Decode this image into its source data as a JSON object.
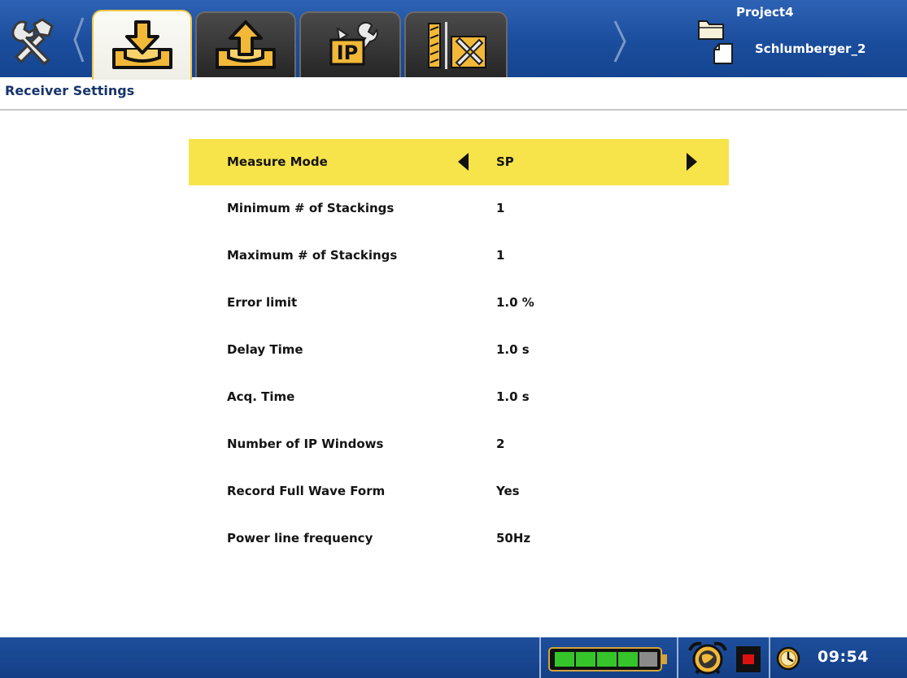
{
  "header": {
    "project": "Project4",
    "file": "Schlumberger_2",
    "tabs": [
      {
        "name": "receiver",
        "icon": "download-tray-icon",
        "active": true
      },
      {
        "name": "transmitter",
        "icon": "upload-tray-icon",
        "active": false
      },
      {
        "name": "ip",
        "icon": "ip-tools-icon",
        "active": false
      },
      {
        "name": "tools",
        "icon": "drill-tools-icon",
        "active": false
      }
    ]
  },
  "page": {
    "title": "Receiver Settings"
  },
  "settings": [
    {
      "label": "Measure Mode",
      "value": "SP",
      "selected": true
    },
    {
      "label": "Minimum # of Stackings",
      "value": "1"
    },
    {
      "label": "Maximum # of Stackings",
      "value": "1"
    },
    {
      "label": "Error limit",
      "value": "1.0 %"
    },
    {
      "label": "Delay Time",
      "value": "1.0 s"
    },
    {
      "label": "Acq. Time",
      "value": "1.0 s"
    },
    {
      "label": "Number of IP Windows",
      "value": "2"
    },
    {
      "label": "Record Full Wave Form",
      "value": "Yes"
    },
    {
      "label": "Power line frequency",
      "value": "50Hz"
    }
  ],
  "status": {
    "time": "09:54",
    "battery_level": 0.8,
    "colors": {
      "highlight": "#f7e34a",
      "bar_blue": "#1a4d9c",
      "title_blue": "#17356c"
    }
  }
}
